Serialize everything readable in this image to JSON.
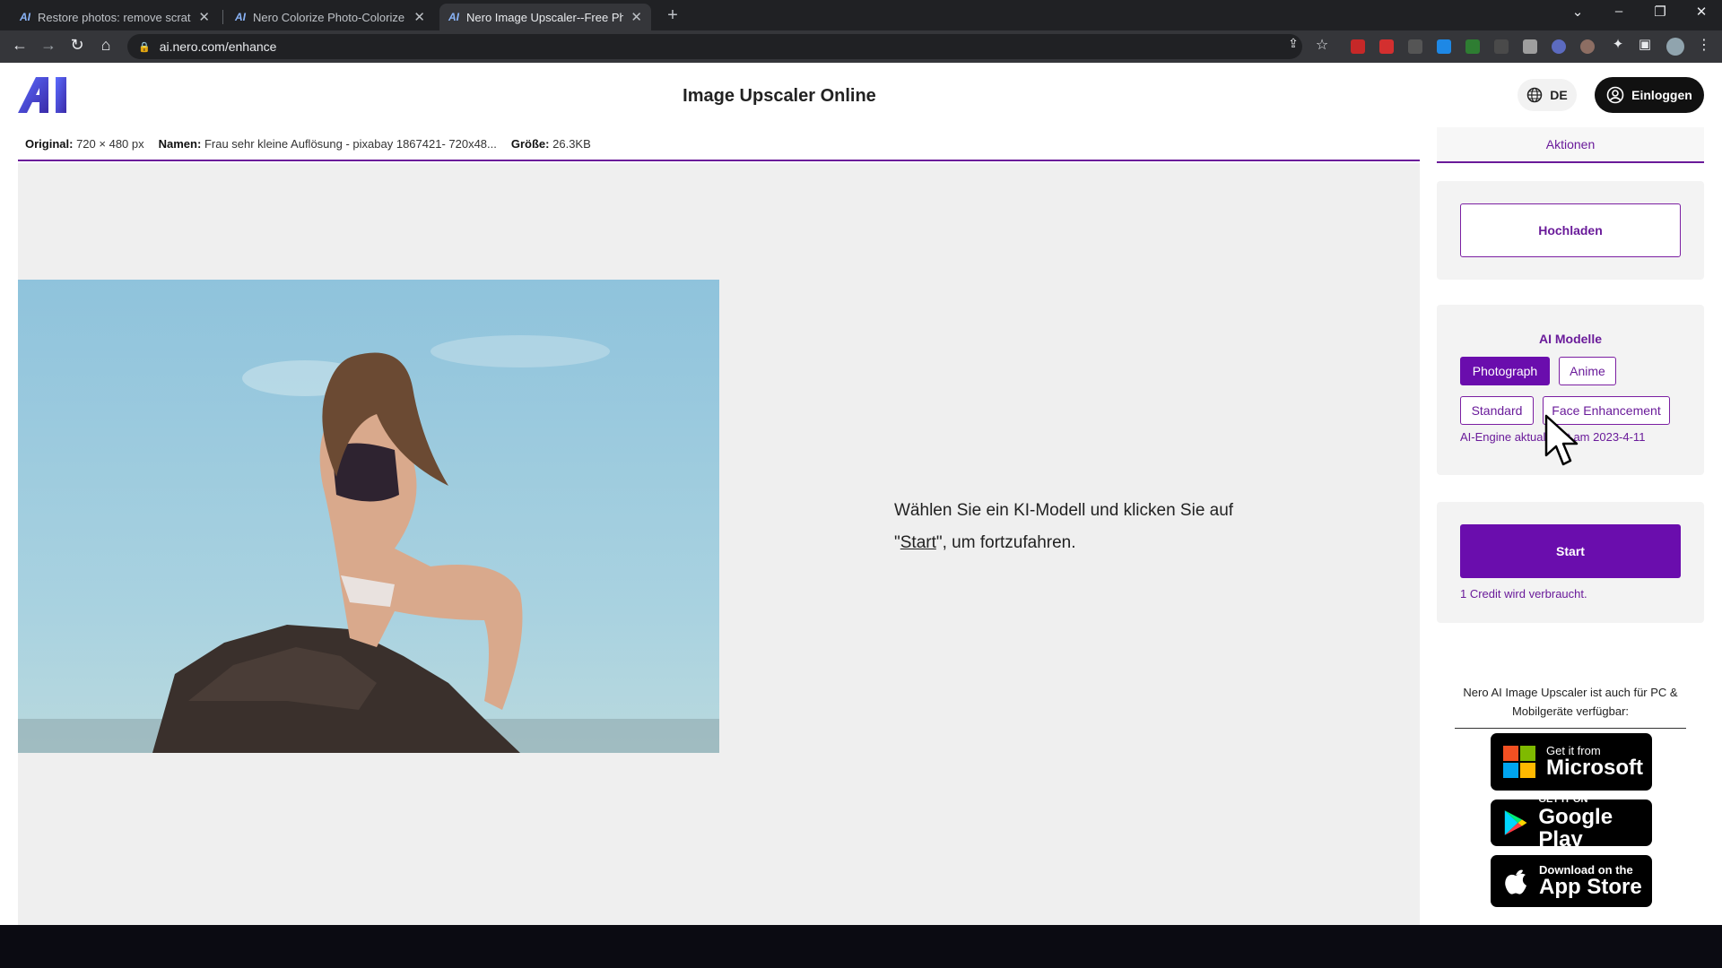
{
  "browser": {
    "tabs": [
      {
        "title": "Restore photos: remove scratche",
        "favicon": "AI"
      },
      {
        "title": "Nero Colorize Photo-Colorize Yo",
        "favicon": "AI"
      },
      {
        "title": "Nero Image Upscaler--Free Photo",
        "favicon": "AI",
        "active": true
      }
    ],
    "url": "ai.nero.com/enhance"
  },
  "header": {
    "title": "Image Upscaler Online",
    "language": "DE",
    "login_label": "Einloggen"
  },
  "info": {
    "original_label": "Original:",
    "original_value": "720 × 480 px",
    "name_label": "Namen:",
    "name_value": "Frau sehr kleine Auflösung - pixabay 1867421- 720x48...",
    "size_label": "Größe:",
    "size_value": "26.3KB"
  },
  "main": {
    "hint_part1": "Wählen Sie ein KI-Modell und klicken Sie auf \"",
    "hint_link": "Start",
    "hint_part2": "\", um fortzufahren."
  },
  "sidebar": {
    "actions_tab": "Aktionen",
    "upload_label": "Hochladen",
    "models_title": "AI Modelle",
    "models": [
      {
        "label": "Photograph",
        "selected": true
      },
      {
        "label": "Anime",
        "selected": false
      },
      {
        "label": "Standard",
        "selected": false
      },
      {
        "label": "Face Enhancement",
        "selected": false
      }
    ],
    "engine_note": "AI-Engine aktualisiert am 2023-4-11",
    "start_label": "Start",
    "credit_note": "1 Credit wird verbraucht.",
    "availability": "Nero AI Image Upscaler ist auch für PC & Mobilgeräte verfügbar:",
    "stores": {
      "microsoft_small": "Get it from",
      "microsoft_big": "Microsoft",
      "google_small": "GET IT ON",
      "google_big": "Google Play",
      "apple_small": "Download on the",
      "apple_big": "App Store"
    }
  },
  "colors": {
    "accent": "#6a0dad",
    "accent_text": "#6a1b9a",
    "canvas_bg": "#efefef"
  }
}
